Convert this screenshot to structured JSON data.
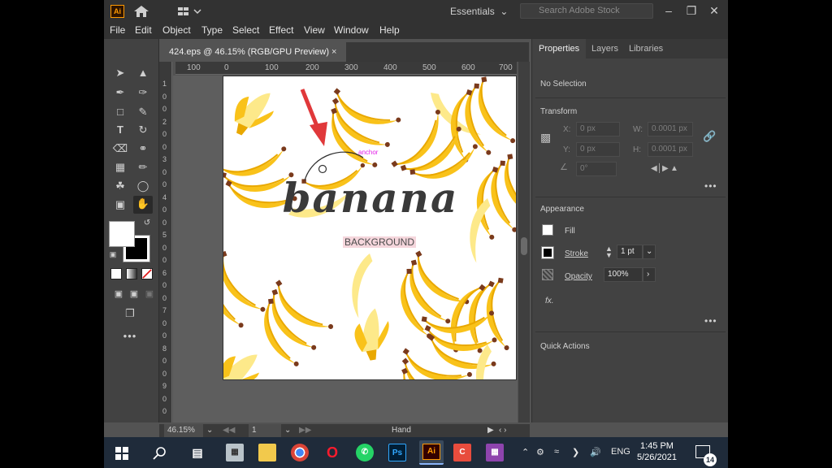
{
  "titlebar": {
    "app_logo": "Ai",
    "workspace": "Essentials",
    "stock_placeholder": "Search Adobe Stock"
  },
  "menu": [
    "File",
    "Edit",
    "Object",
    "Type",
    "Select",
    "Effect",
    "View",
    "Window",
    "Help"
  ],
  "document": {
    "tab_title": "424.eps @ 46.15% (RGB/GPU Preview)",
    "close": "×"
  },
  "ruler": {
    "h_ticks": [
      "100",
      "0",
      "100",
      "200",
      "300",
      "400",
      "500",
      "600",
      "700"
    ],
    "v_ticks": [
      "1",
      "0",
      "0",
      "2",
      "0",
      "0",
      "3",
      "0",
      "0",
      "4",
      "0",
      "0",
      "5",
      "0",
      "0",
      "6",
      "0",
      "0",
      "7",
      "0",
      "0",
      "8",
      "0",
      "0",
      "9",
      "0",
      "0"
    ]
  },
  "artwork": {
    "title": "banana",
    "subtitle": "BACKGROUND",
    "anchor_label": "anchor"
  },
  "statusbar": {
    "zoom": "46.15%",
    "page": "1",
    "tool": "Hand"
  },
  "properties": {
    "tabs": [
      "Properties",
      "Layers",
      "Libraries"
    ],
    "selection": "No Selection",
    "transform": {
      "title": "Transform",
      "x_label": "X:",
      "x_value": "0 px",
      "y_label": "Y:",
      "y_value": "0 px",
      "w_label": "W:",
      "w_value": "0.0001 px",
      "h_label": "H:",
      "h_value": "0.0001 px",
      "angle_value": "0°"
    },
    "appearance": {
      "title": "Appearance",
      "fill_label": "Fill",
      "stroke_label": "Stroke",
      "stroke_value": "1 pt",
      "opacity_label": "Opacity",
      "opacity_value": "100%",
      "fx_label": "fx."
    },
    "quick_actions": "Quick Actions"
  },
  "taskbar": {
    "language": "ENG",
    "time": "1:45 PM",
    "date": "5/26/2021",
    "notifications": "14"
  },
  "colors": {
    "banana_yellow": "#f9c21a",
    "banana_light": "#fde98a",
    "banana_tip": "#7a3a1c",
    "accent_arrow": "#e0383a"
  }
}
